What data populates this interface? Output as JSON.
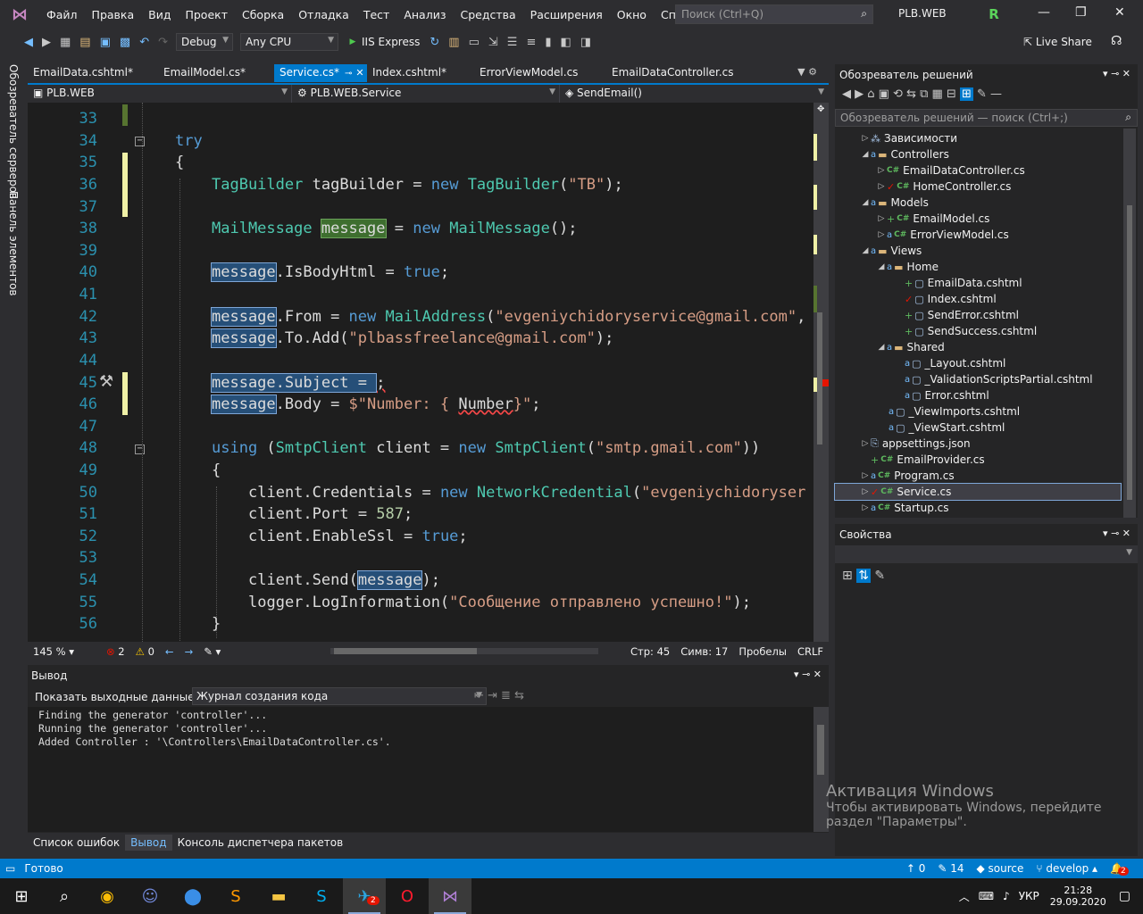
{
  "menu": {
    "items": [
      "Файл",
      "Правка",
      "Вид",
      "Проект",
      "Сборка",
      "Отладка",
      "Тест",
      "Анализ",
      "Средства",
      "Расширения",
      "Окно",
      "Справка"
    ],
    "search_placeholder": "Поиск (Ctrl+Q)",
    "project_name": "PLB.WEB",
    "avatar_letter": "R"
  },
  "toolbar": {
    "config": "Debug",
    "platform": "Any CPU",
    "run_target": "IIS Express",
    "live_share": "Live Share"
  },
  "side_strip": {
    "server_explorer": "Обозреватель серверов",
    "toolbox": "Панель элементов"
  },
  "tabs": [
    {
      "label": "EmailData.cshtml*",
      "active": false
    },
    {
      "label": "EmailModel.cs*",
      "active": false
    },
    {
      "label": "Service.cs*",
      "active": true
    },
    {
      "label": "Index.cshtml*",
      "active": false
    },
    {
      "label": "ErrorViewModel.cs",
      "active": false
    },
    {
      "label": "EmailDataController.cs",
      "active": false
    }
  ],
  "navbar": {
    "project": "PLB.WEB",
    "class": "PLB.WEB.Service",
    "member": "SendEmail()"
  },
  "code_lines": [
    {
      "n": "33"
    },
    {
      "n": "34"
    },
    {
      "n": "35"
    },
    {
      "n": "36"
    },
    {
      "n": "37"
    },
    {
      "n": "38"
    },
    {
      "n": "39"
    },
    {
      "n": "40"
    },
    {
      "n": "41"
    },
    {
      "n": "42"
    },
    {
      "n": "43"
    },
    {
      "n": "44"
    },
    {
      "n": "45"
    },
    {
      "n": "46"
    },
    {
      "n": "47"
    },
    {
      "n": "48"
    },
    {
      "n": "49"
    },
    {
      "n": "50"
    },
    {
      "n": "51"
    },
    {
      "n": "52"
    },
    {
      "n": "53"
    },
    {
      "n": "54"
    },
    {
      "n": "55"
    },
    {
      "n": "56"
    }
  ],
  "code": {
    "l34": "try",
    "l35": "{",
    "l36": {
      "t": "TagBuilder",
      "v": "tagBuilder",
      "eq": "=",
      "kw": "new",
      "t2": "TagBuilder",
      "open": "(",
      "s": "\"TB\"",
      "close": ");"
    },
    "l38": {
      "t": "MailMessage",
      "v": "message",
      "eq": "=",
      "kw": "new",
      "t2": "MailMessage",
      "rest": "();"
    },
    "l40": {
      "v": "message",
      "p": ".IsBodyHtml = ",
      "kw": "true",
      "end": ";"
    },
    "l42": {
      "v": "message",
      "p": ".From = ",
      "kw": "new",
      "t": "MailAddress",
      "open": "(",
      "s": "\"evgeniychidoryservice@gmail.com\"",
      "end": ","
    },
    "l43": {
      "v": "message",
      "p": ".To.Add(",
      "s": "\"plbassfreelance@gmail.com\"",
      "end": ");"
    },
    "l45": {
      "v": "message",
      "p": ".Subject = ",
      "end": ";"
    },
    "l46": {
      "v": "message",
      "p": ".Body = ",
      "s1": "$\"Number: { ",
      "squig": "Number",
      "s2": "}\"",
      "end": ";"
    },
    "l48": {
      "kw": "using",
      "open": " (",
      "t": "SmtpClient",
      "v": " client = ",
      "kw2": "new",
      "t2": " SmtpClient",
      "open2": "(",
      "s": "\"smtp.gmail.com\"",
      "end": "))"
    },
    "l49": "{",
    "l50": {
      "v": "client.Credentials = ",
      "kw": "new",
      "t": " NetworkCredential",
      "open": "(",
      "s": "\"evgeniychidoryser"
    },
    "l51": {
      "v": "client.Port = ",
      "n": "587",
      "end": ";"
    },
    "l52": {
      "v": "client.EnableSsl = ",
      "kw": "true",
      "end": ";"
    },
    "l54": {
      "v": "client.Send(",
      "sel": "message",
      "end": ");"
    },
    "l55": {
      "v": "logger.LogInformation(",
      "s": "\"Сообщение отправлено успешно!\"",
      "end": ");"
    },
    "l56": "}"
  },
  "editor_status": {
    "zoom": "145 %",
    "errors": "2",
    "warnings": "0",
    "line": "Стр: 45",
    "col": "Симв: 17",
    "spaces": "Пробелы",
    "eol": "CRLF"
  },
  "output": {
    "title": "Вывод",
    "show_label": "Показать выходные данные из:",
    "source": "Журнал создания кода",
    "lines": [
      "Finding the generator 'controller'...",
      "Running the generator 'controller'...",
      "Added Controller : '\\Controllers\\EmailDataController.cs'."
    ]
  },
  "bottom_tabs": [
    "Список ошибок",
    "Вывод",
    "Консоль диспетчера пакетов"
  ],
  "solution": {
    "title": "Обозреватель решений",
    "search_placeholder": "Обозреватель решений — поиск (Ctrl+;)",
    "items": [
      "Зависимости",
      "Controllers",
      "EmailDataController.cs",
      "HomeController.cs",
      "Models",
      "EmailModel.cs",
      "ErrorViewModel.cs",
      "Views",
      "Home",
      "EmailData.cshtml",
      "Index.cshtml",
      "SendError.cshtml",
      "SendSuccess.cshtml",
      "Shared",
      "_Layout.cshtml",
      "_ValidationScriptsPartial.cshtml",
      "Error.cshtml",
      "_ViewImports.cshtml",
      "_ViewStart.cshtml",
      "appsettings.json",
      "EmailProvider.cs",
      "Program.cs",
      "Service.cs",
      "Startup.cs"
    ]
  },
  "properties": {
    "title": "Свойства"
  },
  "activation": {
    "title": "Активация Windows",
    "line1": "Чтобы активировать Windows, перейдите",
    "line2": "раздел \"Параметры\"."
  },
  "statusbar": {
    "ready": "Готово",
    "up": "0",
    "pen": "14",
    "source": "source",
    "branch": "develop",
    "notif": "2"
  },
  "taskbar": {
    "lang": "УКР",
    "time": "21:28",
    "date": "29.09.2020",
    "notif_count": "2"
  }
}
